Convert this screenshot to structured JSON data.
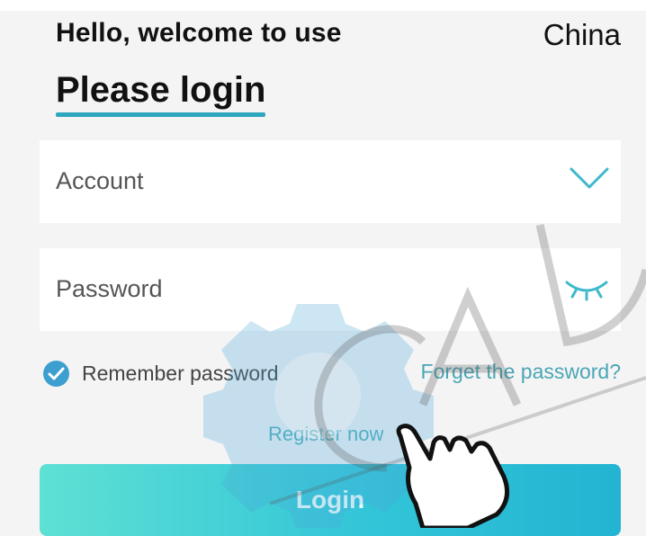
{
  "header": {
    "greeting": "Hello, welcome to use",
    "region": "China",
    "title": "Please login"
  },
  "form": {
    "account_label": "Account",
    "password_label": "Password",
    "account_icon": "chevron-down-icon",
    "password_icon": "eye-closed-icon"
  },
  "options": {
    "remember_label": "Remember password",
    "remember_checked": true,
    "forgot_label": "Forget the password?",
    "register_label": "Register now"
  },
  "login": {
    "button_label": "Login"
  },
  "colors": {
    "accent": "#2ea7be",
    "checkbox": "#3d9fcf",
    "link": "#4aa6b5",
    "button_gradient_start": "#5ee0d4",
    "button_gradient_end": "#22b4d2"
  }
}
